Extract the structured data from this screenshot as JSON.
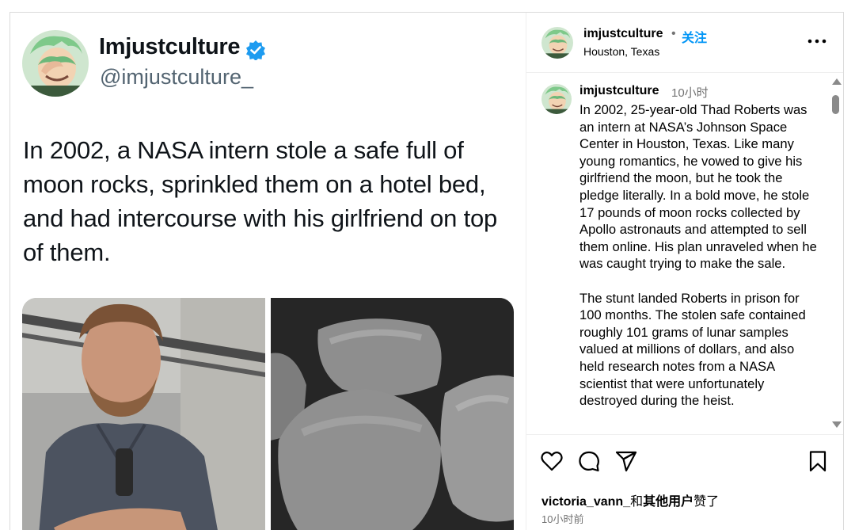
{
  "tweet": {
    "name": "Imjustculture",
    "handle": "@imjustculture_",
    "text": "In 2002, a NASA intern stole a safe full of moon rocks, sprinkled them on a hotel bed, and had intercourse with his girlfriend on top of them."
  },
  "header": {
    "username": "imjustculture",
    "dot": "•",
    "follow_label": "关注",
    "location": "Houston, Texas"
  },
  "caption": {
    "username": "imjustculture",
    "time": "10小时",
    "text": "In 2002, 25-year-old Thad Roberts was an intern at NASA’s Johnson Space Center in Houston, Texas. Like many young romantics, he vowed to give his girlfriend the moon, but he took the pledge literally. In a bold move, he stole 17 pounds of moon rocks collected by Apollo astronauts and attempted to sell them online. His plan unraveled when he was caught trying to make the sale.\n\nThe stunt landed Roberts in prison for 100 months. The stolen safe contained roughly 101 grams of lunar samples valued at millions of dollars, and also held research notes from a NASA scientist that were unfortunately destroyed during the heist."
  },
  "likes": {
    "user": "victoria_vann_",
    "connector": "和",
    "others": "其他用户",
    "suffix": "赞了"
  },
  "post_age": "10小时前",
  "icons": [
    "heart-icon",
    "comment-icon",
    "share-icon",
    "bookmark-icon",
    "more-icon",
    "verified-badge-icon"
  ],
  "colors": {
    "accent": "#0095f6",
    "muted": "#737373",
    "verified": "#1d9bf0"
  }
}
